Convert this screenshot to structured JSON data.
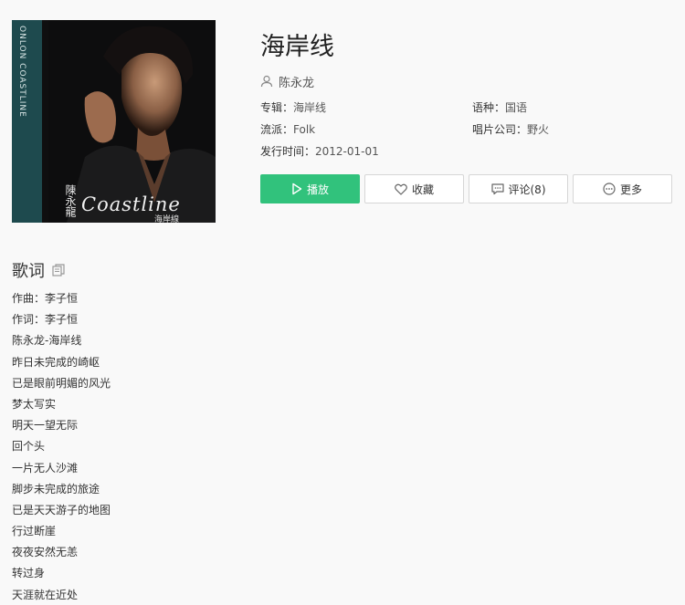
{
  "song": {
    "title": "海岸线",
    "artist": "陈永龙"
  },
  "cover": {
    "side_text": "ONLON COASTLINE",
    "artist_name": "陳永龍",
    "title_script": "Coastline",
    "subtitle": "海岸線"
  },
  "meta": {
    "album_label": "专辑：",
    "album_value": "海岸线",
    "language_label": "语种：",
    "language_value": "国语",
    "genre_label": "流派：",
    "genre_value": "Folk",
    "label_label": "唱片公司：",
    "label_value": "野火",
    "release_label": "发行时间：",
    "release_value": "2012-01-01"
  },
  "actions": {
    "play": "播放",
    "favorite": "收藏",
    "comment": "评论(8)",
    "more": "更多"
  },
  "lyrics": {
    "heading": "歌词",
    "lines": [
      "作曲：李子恒",
      "作词：李子恒",
      "陈永龙-海岸线",
      "昨日未完成的崎岖",
      "已是眼前明媚的风光",
      "梦太写实",
      "明天一望无际",
      "回个头",
      "一片无人沙滩",
      "脚步未完成的旅途",
      "已是天天游子的地图",
      "行过断崖",
      "夜夜安然无恙",
      "转过身",
      "天涯就在近处"
    ]
  },
  "colors": {
    "accent": "#31c27c",
    "background": "#f9f9f9",
    "cover_band": "#1e4a4e"
  },
  "icons": {
    "artist": "user-icon",
    "play": "play-icon",
    "favorite": "heart-icon",
    "comment": "comment-icon",
    "more": "more-icon",
    "copy": "copy-icon"
  }
}
